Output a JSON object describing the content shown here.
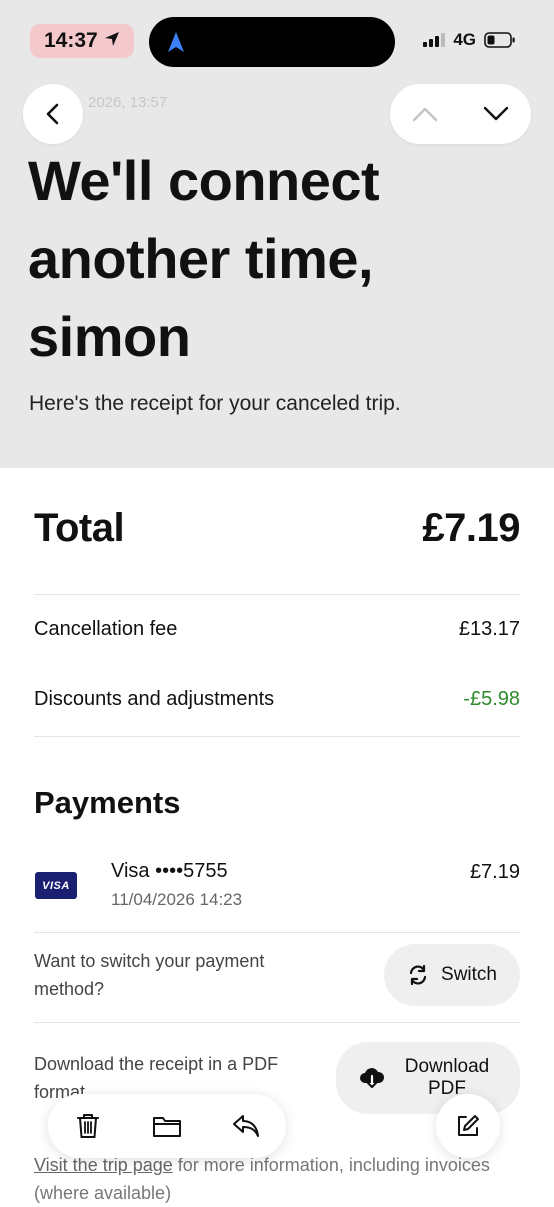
{
  "status_bar": {
    "time": "14:37",
    "network": "4G"
  },
  "header": {
    "faded_date": "2026, 13:57",
    "title": "We'll connect another time, simon",
    "subtitle": "Here's the receipt for your canceled trip."
  },
  "receipt": {
    "total_label": "Total",
    "total_value": "£7.19",
    "lines": [
      {
        "label": "Cancellation fee",
        "value": "£13.17"
      },
      {
        "label": "Discounts and adjustments",
        "value": "-£5.98"
      }
    ]
  },
  "payments": {
    "title": "Payments",
    "card_brand": "VISA",
    "card_name": "Visa ••••5755",
    "date": "11/04/2026 14:23",
    "amount": "£7.19",
    "switch_prompt": "Want to switch your payment method?",
    "switch_label": "Switch",
    "download_prompt": "Download the receipt in a PDF format.",
    "download_label": "Download PDF"
  },
  "footer": {
    "link_text": "Visit the trip page",
    "rest_text": " for more information, including invoices (where available)"
  },
  "colors": {
    "header_bg": "#e8e8e8",
    "discount_green": "#2e8b2e",
    "visa_blue": "#1a1f71"
  }
}
